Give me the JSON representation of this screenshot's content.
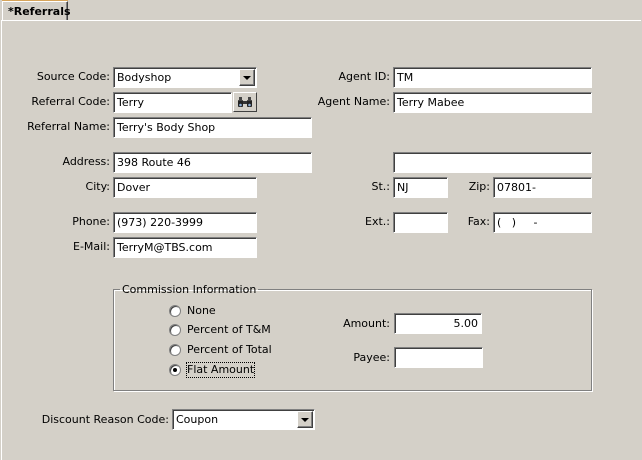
{
  "tab": {
    "label": "*Referrals"
  },
  "form": {
    "source_code": {
      "label": "Source Code:",
      "value": "Bodyshop"
    },
    "referral_code": {
      "label": "Referral Code:",
      "value": "Terry"
    },
    "referral_name": {
      "label": "Referral Name:",
      "value": "Terry's Body Shop"
    },
    "address": {
      "label": "Address:",
      "value": "398 Route 46"
    },
    "address2": {
      "value": ""
    },
    "city": {
      "label": "City:",
      "value": "Dover"
    },
    "phone": {
      "label": "Phone:",
      "value": "(973) 220-3999"
    },
    "email": {
      "label": "E-Mail:",
      "value": "TerryM@TBS.com"
    },
    "agent_id": {
      "label": "Agent ID:",
      "value": "TM"
    },
    "agent_name": {
      "label": "Agent Name:",
      "value": "Terry Mabee"
    },
    "state": {
      "label": "St.:",
      "value": "NJ"
    },
    "zip": {
      "label": "Zip:",
      "value": "07801-"
    },
    "ext": {
      "label": "Ext.:",
      "value": ""
    },
    "fax": {
      "label": "Fax:",
      "value": "(   )     -"
    }
  },
  "commission": {
    "legend": "Commission Information",
    "options": [
      "None",
      "Percent of T&M",
      "Percent of Total",
      "Flat Amount"
    ],
    "selected": "Flat Amount",
    "amount": {
      "label": "Amount:",
      "value": "5.00"
    },
    "payee": {
      "label": "Payee:",
      "value": ""
    }
  },
  "discount": {
    "label": "Discount Reason Code:",
    "value": "Coupon"
  },
  "icons": {
    "lookup": "binoculars-icon",
    "dropdown": "chevron-down-icon"
  }
}
